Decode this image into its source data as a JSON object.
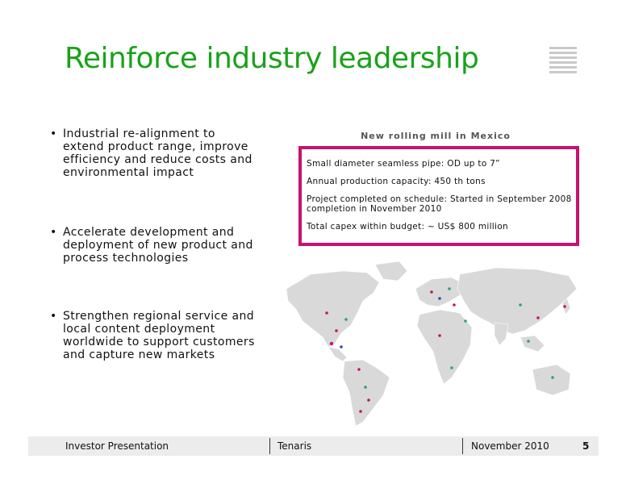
{
  "slide": {
    "title": "Reinforce industry leadership",
    "bullets": [
      {
        "symbol": "•",
        "text": "Industrial re-alignment to extend product range, improve efficiency and reduce costs and environmental impact"
      },
      {
        "symbol": "•",
        "text": "Accelerate development and deployment of new product and process technologies"
      },
      {
        "symbol": "•",
        "text": "Strengthen regional service and local content deployment worldwide to support customers and capture new markets"
      }
    ]
  },
  "panel": {
    "heading": "New rolling mill in Mexico",
    "lines": [
      "Small diameter seamless pipe: OD up to 7”",
      "Annual production capacity: 450 th tons",
      "Project completed on schedule: Started in September 2008 completion in November 2010",
      "Total capex within budget: ~ US$ 800 million"
    ]
  },
  "colors": {
    "title_green": "#1aa21a",
    "box_magenta": "#c8126e",
    "map_land": "#d9d9d9",
    "marker_magenta": "#c8126e",
    "marker_green": "#2aa56b",
    "marker_blue": "#2a4fa5"
  },
  "footer": {
    "left": "Investor Presentation",
    "center": "Tenaris",
    "date": "November 2010",
    "page": "5"
  }
}
